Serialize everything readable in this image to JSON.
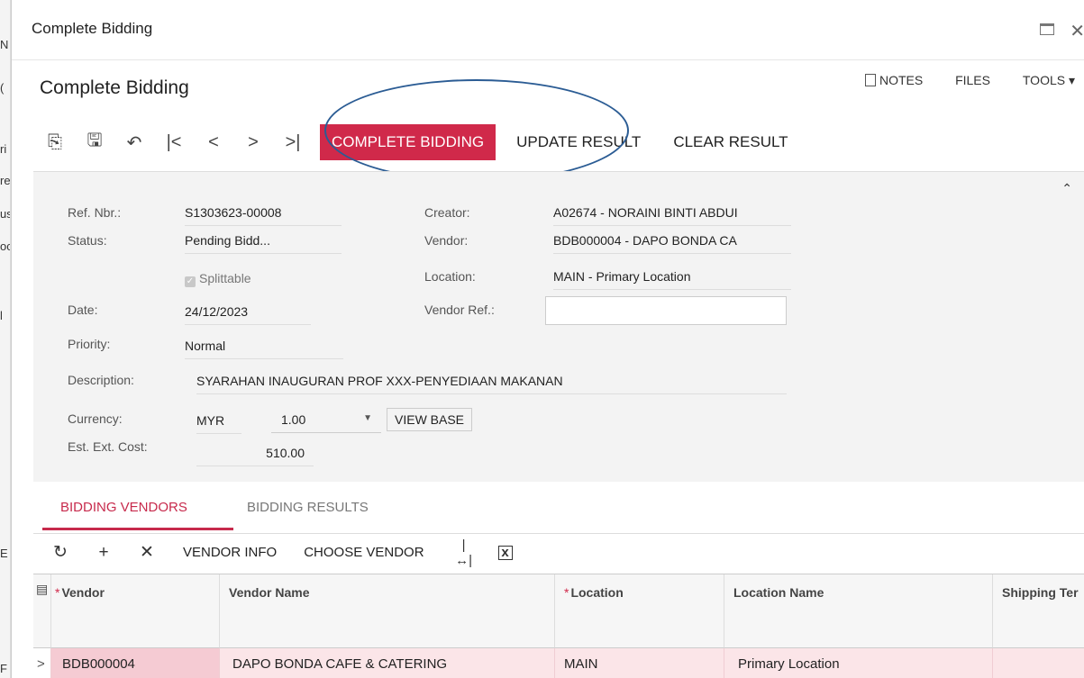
{
  "background_strip": [
    "N",
    "(",
    "ri",
    "re",
    "us",
    "oc",
    "l",
    "E",
    "F"
  ],
  "dialog": {
    "title": "Complete Bidding",
    "page_title": "Complete Bidding",
    "top_links": {
      "notes": "NOTES",
      "files": "FILES",
      "tools": "TOOLS ▾"
    }
  },
  "toolbar": {
    "icons": [
      "copy-paste-icon",
      "save-icon",
      "undo-icon",
      "first-record-icon",
      "prev-record-icon",
      "next-record-icon",
      "last-record-icon"
    ],
    "complete_bidding": "COMPLETE BIDDING",
    "update_result": "UPDATE RESULT",
    "clear_result": "CLEAR RESULT"
  },
  "form": {
    "ref_nbr_label": "Ref. Nbr.:",
    "ref_nbr": "S1303623-00008",
    "status_label": "Status:",
    "status": "Pending Bidd...",
    "splittable": "Splittable",
    "date_label": "Date:",
    "date": "24/12/2023",
    "priority_label": "Priority:",
    "priority": "Normal",
    "description_label": "Description:",
    "description": "SYARAHAN INAUGURAN PROF XXX-PENYEDIAAN MAKANAN",
    "currency_label": "Currency:",
    "currency": "MYR",
    "rate": "1.00",
    "view_base": "VIEW BASE",
    "est_ext_cost_label": "Est. Ext. Cost:",
    "est_ext_cost": "510.00",
    "creator_label": "Creator:",
    "creator": "A02674 - NORAINI BINTI ABDUI",
    "vendor_label": "Vendor:",
    "vendor": "BDB000004 - DAPO BONDA CA",
    "location_label": "Location:",
    "location": "MAIN - Primary Location",
    "vendor_ref_label": "Vendor Ref.:",
    "vendor_ref": ""
  },
  "tabs": {
    "active": "BIDDING VENDORS",
    "inactive": "BIDDING RESULTS"
  },
  "grid_toolbar": {
    "vendor_info": "VENDOR INFO",
    "choose_vendor": "CHOOSE VENDOR"
  },
  "grid": {
    "columns": [
      "Vendor",
      "Vendor Name",
      "Location",
      "Location Name",
      "Shipping Ter"
    ],
    "row": {
      "vendor": "BDB000004",
      "vendor_name": "DAPO BONDA CAFE & CATERING",
      "location": "MAIN",
      "location_name": "Primary Location",
      "shipping_terms": ""
    }
  }
}
